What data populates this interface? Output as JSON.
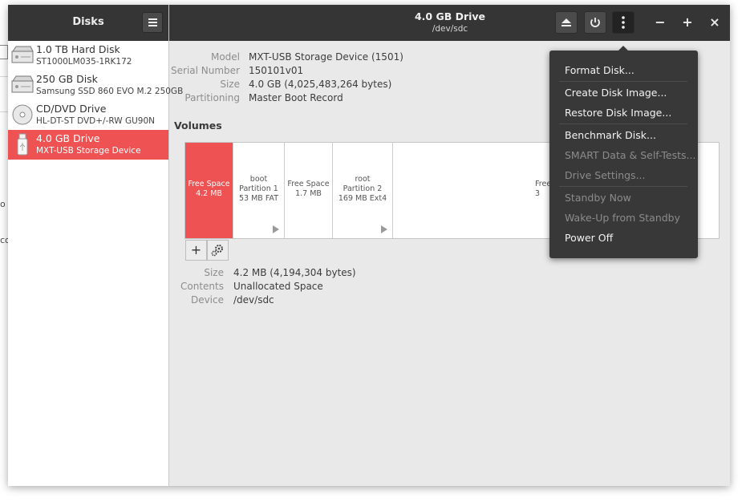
{
  "background": {
    "frag1": "o",
    "frag2": "co"
  },
  "sidebar": {
    "title": "Disks",
    "menu_icon": "hamburger-icon",
    "items": [
      {
        "name": "1.0 TB Hard Disk",
        "model": "ST1000LM035-1RK172",
        "icon": "hard-disk-icon"
      },
      {
        "name": "250 GB Disk",
        "model": "Samsung SSD 860 EVO M.2 250GB",
        "icon": "ssd-icon"
      },
      {
        "name": "CD/DVD Drive",
        "model": "HL-DT-ST DVD+/-RW GU90N",
        "icon": "optical-disc-icon"
      },
      {
        "name": "4.0 GB Drive",
        "model": "MXT-USB Storage Device",
        "icon": "usb-drive-icon",
        "selected": true
      }
    ]
  },
  "header": {
    "title": "4.0 GB Drive",
    "subtitle": "/dev/sdc",
    "buttons": [
      "eject-icon",
      "power-icon",
      "kebab-menu-icon"
    ],
    "window_controls": {
      "minimize": "−",
      "maximize": "+",
      "close": "×"
    }
  },
  "drive": {
    "model_label": "Model",
    "model": "MXT-USB Storage Device (1501)",
    "serial_label": "Serial Number",
    "serial": "150101v01",
    "size_label": "Size",
    "size": "4.0 GB (4,025,483,264 bytes)",
    "partitioning_label": "Partitioning",
    "partitioning": "Master Boot Record"
  },
  "volumes": {
    "title": "Volumes",
    "partitions": [
      {
        "line1": "Free Space",
        "line2": "4.2 MB",
        "line3": "",
        "selected": true
      },
      {
        "line1": "boot",
        "line2": "Partition 1",
        "line3": "53 MB FAT",
        "arrow": true
      },
      {
        "line1": "Free Space",
        "line2": "1.7 MB",
        "line3": ""
      },
      {
        "line1": "root",
        "line2": "Partition 2",
        "line3": "169 MB Ext4",
        "arrow": true
      },
      {
        "line1": "Free",
        "line2": "3",
        "line3": ""
      }
    ],
    "add_symbol": "+",
    "add_icon": "plus-icon",
    "settings_icon": "gears-icon"
  },
  "selected_volume": {
    "size_label": "Size",
    "size": "4.2 MB (4,194,304 bytes)",
    "contents_label": "Contents",
    "contents": "Unallocated Space",
    "device_label": "Device",
    "device": "/dev/sdc"
  },
  "menu": {
    "items": [
      {
        "label": "Format Disk...",
        "enabled": true
      },
      {
        "label": "Create Disk Image...",
        "enabled": true
      },
      {
        "label": "Restore Disk Image...",
        "enabled": true
      },
      {
        "label": "Benchmark Disk...",
        "enabled": true
      },
      {
        "label": "SMART Data & Self-Tests...",
        "enabled": false
      },
      {
        "label": "Drive Settings...",
        "enabled": false
      },
      {
        "label": "Standby Now",
        "enabled": false
      },
      {
        "label": "Wake-Up from Standby",
        "enabled": false
      },
      {
        "label": "Power Off",
        "enabled": true
      }
    ]
  },
  "colors": {
    "accent": "#ee5252",
    "headerbar": "#353535",
    "menu_bg": "#383838"
  }
}
